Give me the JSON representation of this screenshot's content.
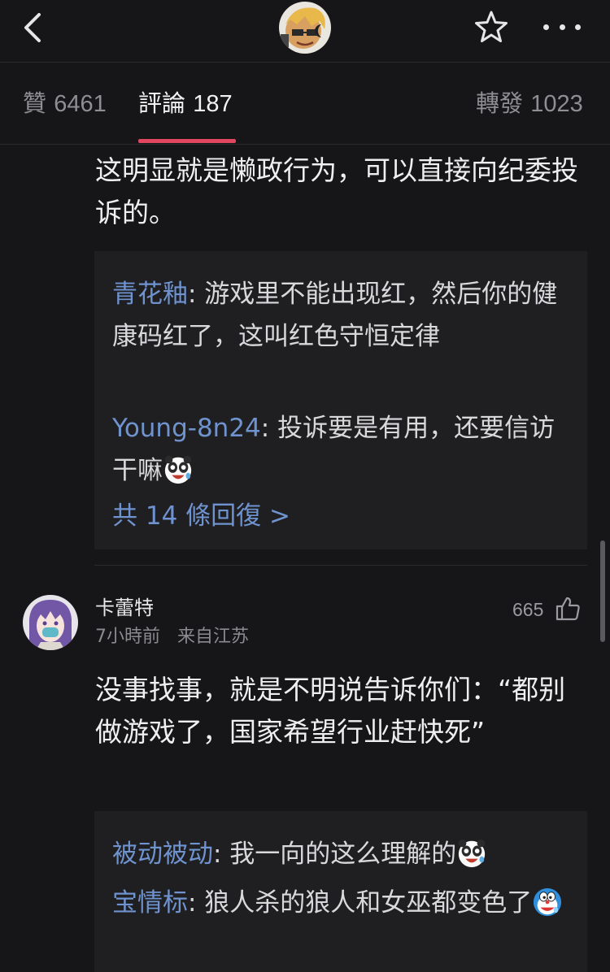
{
  "header": {
    "back_icon": "chevron-left-icon",
    "avatar": "user-avatar",
    "star_icon": "star-icon",
    "more_icon": "more-dots-icon"
  },
  "tabs": {
    "likes": {
      "label": "贊",
      "count": "6461"
    },
    "comments": {
      "label": "評論",
      "count": "187"
    },
    "reposts": {
      "label": "轉發",
      "count": "1023"
    },
    "active_color": "#e3465f"
  },
  "comment1": {
    "text": "这明显就是懒政行为，可以直接向纪委投诉的。",
    "replies": [
      {
        "user": "青花釉",
        "text": ": 游戏里不能出现红，然后你的健康码红了，这叫红色守恒定律"
      },
      {
        "user": "Young-8n24",
        "text": ": 投诉要是有用，还要信访干嘛",
        "emoji": "panda-laugh-emoji"
      }
    ],
    "more_replies": "共 14 條回復 >"
  },
  "comment2": {
    "user": "卡蕾特",
    "time": "7小時前",
    "location": "来自江苏",
    "likes": "665",
    "text": "没事找事，就是不明说告诉你们：“都别做游戏了，国家希望行业赶快死”",
    "replies": [
      {
        "user": "被动被动",
        "text": ": 我一向的这么理解的",
        "emoji": "panda-laugh-emoji"
      },
      {
        "user": "宝情标",
        "text": ": 狼人杀的狼人和女巫都变色了",
        "emoji": "doraemon-emoji"
      }
    ]
  },
  "colors": {
    "background": "#161618",
    "reply_background": "#1f1f22",
    "username_link": "#6f93cf"
  }
}
